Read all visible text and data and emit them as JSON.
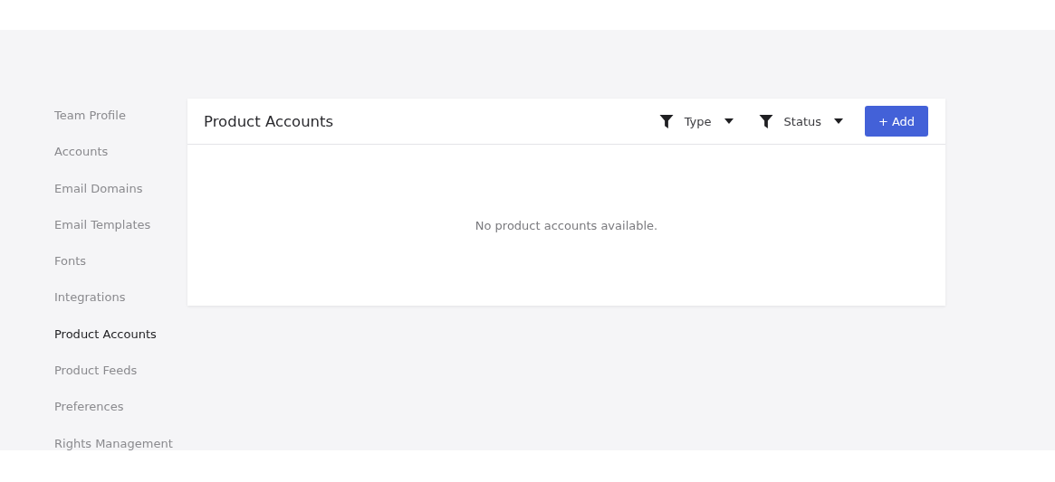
{
  "sidebar": {
    "items": [
      {
        "label": "Team Profile",
        "selected": false
      },
      {
        "label": "Accounts",
        "selected": false
      },
      {
        "label": "Email Domains",
        "selected": false
      },
      {
        "label": "Email Templates",
        "selected": false
      },
      {
        "label": "Fonts",
        "selected": false
      },
      {
        "label": "Integrations",
        "selected": false
      },
      {
        "label": "Product Accounts",
        "selected": true
      },
      {
        "label": "Product Feeds",
        "selected": false
      },
      {
        "label": "Preferences",
        "selected": false
      },
      {
        "label": "Rights Management",
        "selected": false
      }
    ]
  },
  "panel": {
    "title": "Product Accounts",
    "filters": [
      {
        "label": "Type"
      },
      {
        "label": "Status"
      }
    ],
    "add_button": "+ Add",
    "empty_message": "No product accounts available."
  }
}
